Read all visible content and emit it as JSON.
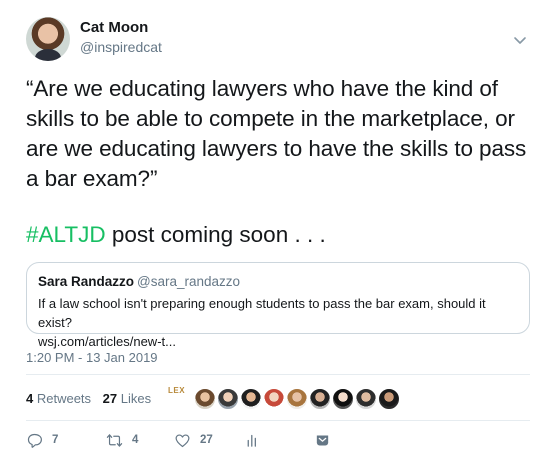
{
  "author": {
    "name": "Cat Moon",
    "handle": "@inspiredcat"
  },
  "tweet": {
    "text": "“Are we educating lawyers who have the kind of skills to be able to compete in the marketplace, or are we educating lawyers to have the skills to pass a bar exam?”",
    "hashtag": "#ALTJD",
    "tail": " post coming soon . . ."
  },
  "quote": {
    "name": "Sara Randazzo",
    "handle": "@sara_randazzo",
    "line1": "If a law school isn't preparing enough students to pass the bar exam, should it exist?",
    "line2": "wsj.com/articles/new-t..."
  },
  "timestamp": "1:20 PM - 13 Jan 2019",
  "stats": {
    "retweets_count": "4",
    "retweets_label": " Retweets",
    "likes_count": "27",
    "likes_label": " Likes",
    "lex_logo_text": "LEX"
  },
  "actions": {
    "reply_count": "7",
    "retweet_count": "4",
    "like_count": "27"
  },
  "colors": {
    "hashtag": "#17bf63",
    "secondary_text": "#657786",
    "accent": "#1da1f2"
  },
  "icons": [
    "chevron-down-icon",
    "reply-icon",
    "retweet-icon",
    "like-icon",
    "analytics-icon",
    "dm-icon"
  ]
}
